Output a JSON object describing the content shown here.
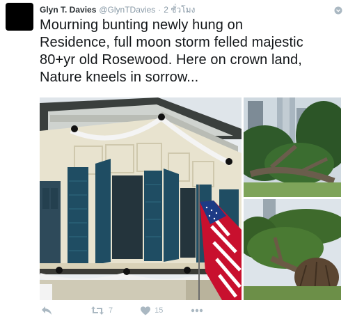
{
  "tweet": {
    "display_name": "Glyn T. Davies",
    "handle": "@GlynTDavies",
    "separator": "·",
    "timestamp": "2 ชั่วโมง",
    "text_lines": [
      "Mourning bunting newly hung on",
      "Residence, full moon storm felled majestic",
      "80+yr old Rosewood. Here on crown land,",
      "Nature kneels in sorrow..."
    ]
  },
  "actions": {
    "retweet_count": "7",
    "like_count": "15"
  },
  "colors": {
    "action_gray": "#aab8c2",
    "meta_gray": "#8899a6",
    "text": "#14171a"
  },
  "icons": {
    "reply": "reply-arrow-icon",
    "retweet": "retweet-icon",
    "like": "heart-icon",
    "more": "more-dots-icon",
    "menu": "chevron-down-icon"
  }
}
